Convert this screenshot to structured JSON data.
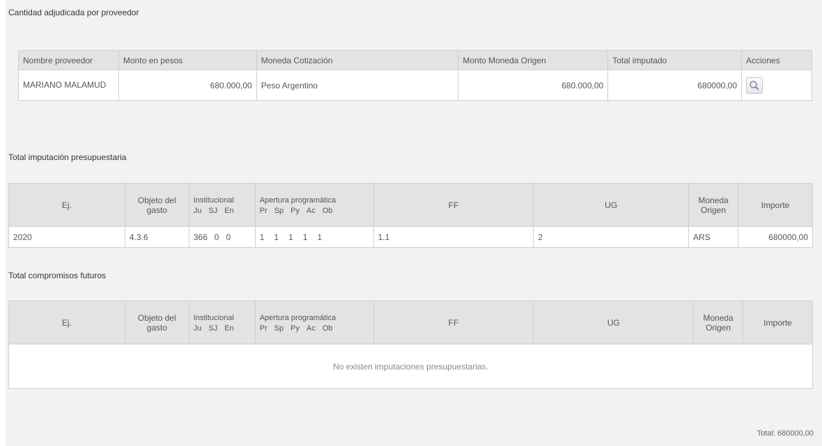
{
  "sections": {
    "proveedor_title": "Cantidad adjudicada por proveedor",
    "imputacion_title": "Total imputación presupuestaria",
    "compromisos_title": "Total compromisos futuros"
  },
  "proveedor_table": {
    "headers": [
      "Nombre proveedor",
      "Monto en pesos",
      "Moneda Cotización",
      "Monto Moneda Origen",
      "Total imputado",
      "Acciones"
    ],
    "row": {
      "nombre": "MARIANO MALAMUD",
      "monto_pesos": "680.000,00",
      "moneda": "Peso Argentino",
      "monto_origen": "680.000,00",
      "total_imputado": "680000,00"
    }
  },
  "budget_headers": {
    "ej": "Ej.",
    "objeto": "Objeto del gasto",
    "institucional": "Institucional",
    "inst_sub": [
      "Ju",
      "SJ",
      "En"
    ],
    "apertura": "Apertura programática",
    "apertura_sub": [
      "Pr",
      "Sp",
      "Py",
      "Ac",
      "Ob"
    ],
    "ff": "FF",
    "ug": "UG",
    "moneda": "Moneda Origen",
    "importe": "Importe"
  },
  "imputacion_row": {
    "ej": "2020",
    "objeto": "4.3.6",
    "inst": [
      "366",
      "0",
      "0"
    ],
    "apertura": [
      "1",
      "1",
      "1",
      "1",
      "1"
    ],
    "ff": "1.1",
    "ug": "2",
    "moneda": "ARS",
    "importe": "680000,00"
  },
  "compromisos_empty": "No existen imputaciones presupuestarias.",
  "footer_total": "Total: 680000,00"
}
